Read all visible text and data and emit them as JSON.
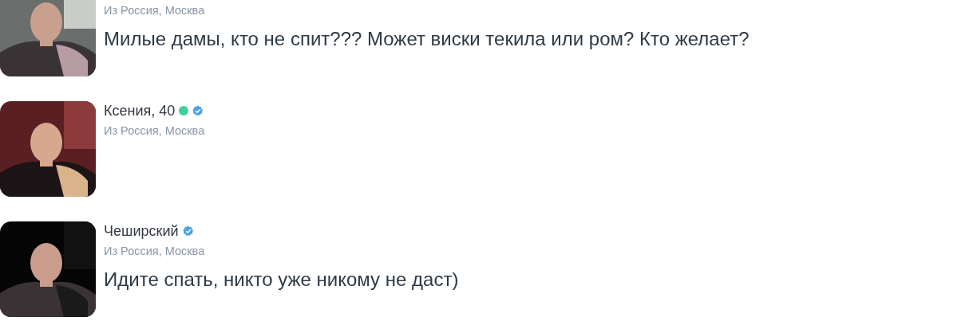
{
  "posts": [
    {
      "location": "Из Россия, Москва",
      "message": "Милые дамы, кто не спит??? Может виски текила или ром? Кто желает?"
    },
    {
      "name": "Ксения, 40",
      "online": true,
      "verified": true,
      "location": "Из Россия, Москва"
    },
    {
      "name": "Чеширский",
      "online": false,
      "verified": true,
      "location": "Из Россия, Москва",
      "message": "Идите спать, никто уже никому не даст)"
    }
  ]
}
